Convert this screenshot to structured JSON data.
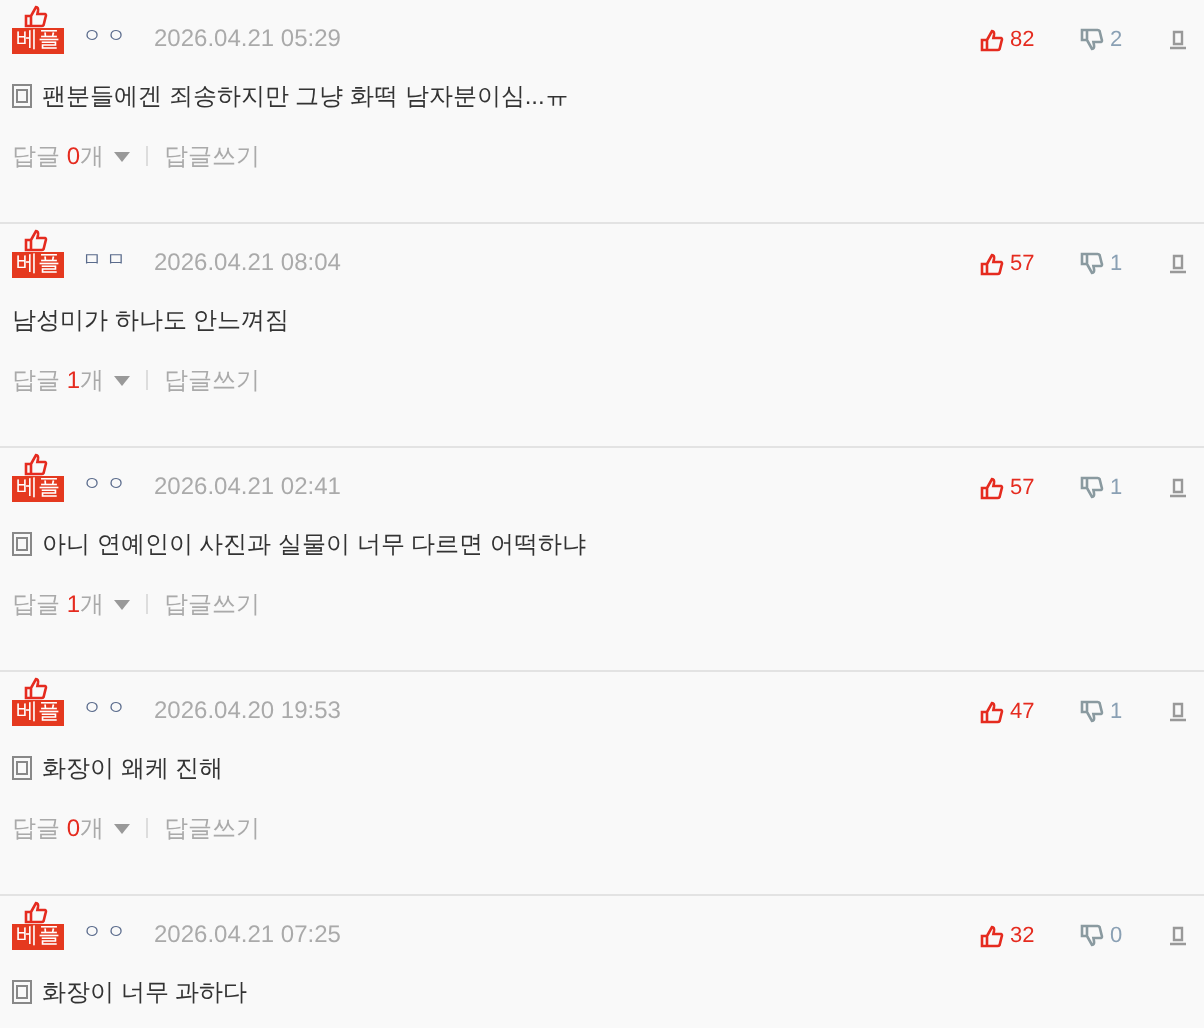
{
  "comments": [
    {
      "badge": "베플",
      "user": "ㅇㅇ",
      "date": "2026.04.21 05:29",
      "likes": "82",
      "dislikes": "2",
      "memo_icon": true,
      "text": "팬분들에겐 죄송하지만 그냥 화떡 남자분이심...ㅠ",
      "reply": {
        "label": "답글",
        "count": "0",
        "unit": "개",
        "write": "답글쓰기"
      }
    },
    {
      "badge": "베플",
      "user": "ㅁㅁ",
      "date": "2026.04.21 08:04",
      "likes": "57",
      "dislikes": "1",
      "memo_icon": false,
      "text": "남성미가 하나도 안느껴짐",
      "reply": {
        "label": "답글",
        "count": "1",
        "unit": "개",
        "write": "답글쓰기"
      }
    },
    {
      "badge": "베플",
      "user": "ㅇㅇ",
      "date": "2026.04.21 02:41",
      "likes": "57",
      "dislikes": "1",
      "memo_icon": true,
      "text": "아니 연예인이 사진과 실물이 너무 다르면 어떡하냐",
      "reply": {
        "label": "답글",
        "count": "1",
        "unit": "개",
        "write": "답글쓰기"
      }
    },
    {
      "badge": "베플",
      "user": "ㅇㅇ",
      "date": "2026.04.20 19:53",
      "likes": "47",
      "dislikes": "1",
      "memo_icon": true,
      "text": "화장이 왜케 진해",
      "reply": {
        "label": "답글",
        "count": "0",
        "unit": "개",
        "write": "답글쓰기"
      }
    },
    {
      "badge": "베플",
      "user": "ㅇㅇ",
      "date": "2026.04.21 07:25",
      "likes": "32",
      "dislikes": "0",
      "memo_icon": true,
      "text": "화장이 너무 과하다"
    }
  ]
}
